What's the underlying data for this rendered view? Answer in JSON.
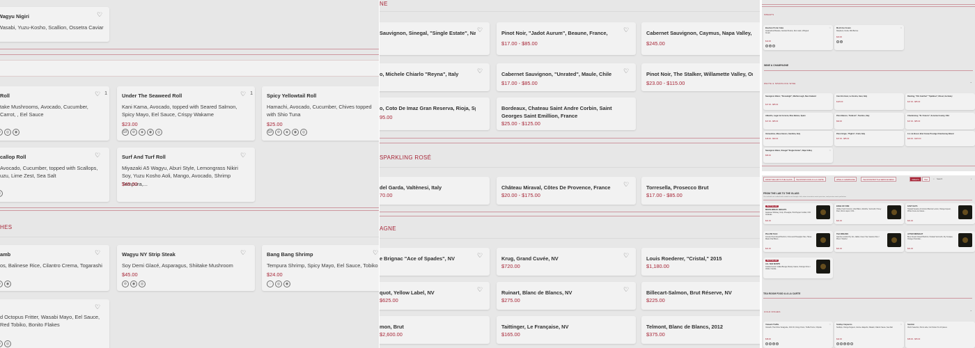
{
  "panel1": {
    "top_card": {
      "name": "Wagyu Nigiri",
      "desc": "Wasabi, Yuzu-Kosho, Scallion, Ossetra Caviar"
    },
    "roll_cards": [
      {
        "name": "Roll",
        "desc": "take Mushrooms, Avocado, Cucumber, Carrot, , Eel Sauce",
        "count": "1"
      },
      {
        "name": "Under The Seaweed Roll",
        "desc": "Kani Kama, Avocado, topped with Seared Salmon, Spicy Mayo, Eel Sauce, Crispy Wakame",
        "price": "$23.00",
        "count": "1"
      },
      {
        "name": "Spicy Yellowtail Roll",
        "desc": "Hamachi, Avocado, Cucumber, Chives topped with Shio Tuna",
        "price": "$25.00"
      },
      {
        "name": "callop Roll",
        "desc": "Avocado, Cucumber, topped with Scallops, uzu, Lime Zest, Sea Salt"
      },
      {
        "name": "Surf And Turf Roll",
        "desc": "Miyazaki A5 Wagyu, Aburi Style, Lemongrass Nikiri Soy, Yuzu Kosho Aoli, Mango, Avocado, Shrimp Tempura,...",
        "price": "$45.00"
      }
    ],
    "section_title": "HES",
    "dish_cards": [
      {
        "name": "amb",
        "desc": "os, Balinese Rice, Cilantro Crema, Togarashi"
      },
      {
        "name": "Wagyu NY Strip Steak",
        "desc": "Soy Demi Glacé, Asparagus, Shiitake Mushroom",
        "price": "$45.00"
      },
      {
        "name": "Bang Bang Shrimp",
        "desc": "Tempura Shrimp, Spicy Mayo, Eel Sauce, Tobiko",
        "price": "$24.00"
      },
      {
        "name": "",
        "desc": "d Octopus Fritter, Wasabi Mayo, Eel Sauce, Red Tobiko, Bonito Flakes"
      }
    ]
  },
  "panel2": {
    "top_section": "NE",
    "wine_rows": [
      [
        {
          "name": "Sauvignon, Sinegal, \"Single Estate\", Napa",
          "price": ""
        },
        {
          "name": "Pinot Noir, \"Jadot Aurum\", Beaune, France,",
          "price": "$17.00 - $85.00"
        },
        {
          "name": "Cabernet Sauvignon, Caymus, Napa Valley, USA",
          "price": "$245.00"
        }
      ],
      [
        {
          "name": "o, Michele Chiarlo \"Reyna\", Italy",
          "price": ""
        },
        {
          "name": "Cabernet Sauvignon, \"Unrated\", Maule, Chile",
          "price": "$17.00 - $85.00"
        },
        {
          "name": "Pinot Noir, The Stalker, Willamette Valley, Orego",
          "price": "$23.00 - $115.00"
        }
      ],
      [
        {
          "name": "o, Coto De Imaz Gran Reserva, Rioja, Spain",
          "price": "95.00"
        },
        {
          "name": "Bordeaux, Chateau Saint Andre Corbin, Saint Georges Saint Emillion, France",
          "price": "$25.00 - $125.00"
        }
      ]
    ],
    "rose_section": "SPARKLING ROSÉ",
    "rose_row": [
      {
        "name": "del Garda, Valtènesi, Italy",
        "price": "70.00"
      },
      {
        "name": "Château Miraval, Côtes De Provence, France",
        "price": "$20.00 - $175.00"
      },
      {
        "name": "Torresella, Prosecco Brut",
        "price": "$17.00 - $85.00"
      }
    ],
    "champagne_section": "AGNE",
    "champagne_rows": [
      [
        {
          "name": "e Brignac \"Ace of Spades\", NV",
          "price": ""
        },
        {
          "name": "Krug, Grand Cuvée, NV",
          "price": "$720.00"
        },
        {
          "name": "Louis Roederer, \"Cristal,\" 2015",
          "price": "$1,180.00"
        }
      ],
      [
        {
          "name": "quot, Yellow Label, NV",
          "price": "$625.00"
        },
        {
          "name": "Ruinart, Blanc de Blancs, NV",
          "price": "$275.00"
        },
        {
          "name": "Billecart-Salmon, Brut Réserve, NV",
          "price": "$225.00"
        }
      ],
      [
        {
          "name": "mon, Brut",
          "price": "$2,600.00"
        },
        {
          "name": "Taittinger, Le Française, NV",
          "price": "$165.00"
        },
        {
          "name": "Telmont, Blanc de Blancs, 2012",
          "price": "$375.00"
        }
      ]
    ]
  },
  "panel3": {
    "sweets_section": "SWEETS",
    "sweets": [
      {
        "name": "Bourbon Porter Cake",
        "desc": "Caramelized Banana, Candied Pecans, Rum raisin, Whipped Cream",
        "price": "$13.00"
      },
      {
        "name": "Mochi Ice Cream",
        "desc": "Raspberry Coulis, Wild Berries",
        "price": "$20.00"
      }
    ],
    "heading": "WINE & CHAMPAGNE",
    "white_section": "WHITE & SPARKLING WINE",
    "whites": [
      {
        "name": "Sauvignon Blanc, \"Stoneleigh\", Marlborough, New Zealand",
        "price": "$17.00 - $85.00"
      },
      {
        "name": "Cavi Gin Gavi, La Scolca, Gavi, Italy",
        "price": "$125.00"
      },
      {
        "name": "Riesling, \"Fitz Gunther\" \"Spätlese\", Mosel, Germany",
        "price": "$17.00 - $85.00"
      },
      {
        "name": "Albariño, Lagar de Cervera, Rías Baixas, Spain",
        "price": "$17.00 - $85.00"
      },
      {
        "name": "Pinot Bianco, \"Kellerei\", Trentino, Italy",
        "price": "$90.00"
      },
      {
        "name": "Chardonnay, \"St. Francis\", Sonoma County, USA",
        "price": "$17.00 - $85.00"
      },
      {
        "name": "Vermentino, Mesa Giunco, Sardinia, Italy",
        "price": "$18.00 - $90.00"
      },
      {
        "name": "Pinot Grigio, \"Pighin\", Friuli, Italy",
        "price": "$17.00 - $85.00"
      },
      {
        "name": "C.J. de Bosco Brut Cuvée Prestige Chardonnay Blend",
        "price": "$23.00 - $115.00"
      },
      {
        "name": "Sauvignon Blanc, Sinegal \"Single Estate\", Napa Valley",
        "price": "$95.00"
      }
    ]
  },
  "panel4": {
    "nav_tabs": [
      "FROM THE LAB TO THE GLASS",
      "TEA ROOM FOOD & A LA CARTE",
      "WINE & CHAMPAGNE",
      "TEA ROOM BOTTLE SERVICE MENU",
      "SWEETS",
      "TEA"
    ],
    "active_tab": "SWEETS",
    "search_label": "Search",
    "heading": "FROM THE LAB TO THE GLASS",
    "intro": "Our cocktails are crafted and curated as art through a lab, where innovative meets precision, and passion meets perfection.",
    "badge": "BESTSELLER",
    "drinks": [
      {
        "name": "MOON BREAK HEIGHTS",
        "desc": "Japanese Whiskey, Umip, Pineapple, Pink Pepper Cordial, CO2 Graduate",
        "price": "$21.00"
      },
      {
        "name": "EDGE OF FIRE",
        "desc": "Vodka, Fresh Coconut, Lillet Blanc, Absinthe, Vermouth, Honey Pear, Citron Liquor, CO2...",
        "price": "$21.00"
      },
      {
        "name": "FAST DAYS",
        "desc": "Toasted Sesame & Coconut Mezcal, Lemon, Orange Liqueur, White Creme de Cacao...",
        "price": "$21.00"
      },
      {
        "name": "PILLOW TALK",
        "desc": "Coconut Tea Infused Bourbon, Citrus and Pineapple Oleo, House Made Chai Bitters...",
        "price": "$21.00"
      },
      {
        "name": "TEA DREAMS",
        "desc": "Jasmine London Dry Gin, Jakkai, Green Tea, Sesame Oleo / Pisco / Sherbet",
        "price": "$21.00"
      },
      {
        "name": "AFTER MIDNIGHT",
        "desc": "Brew Cream Infused Bourbon, Smoked Vermouth, Dry Curaçao, Orange Chocolate...",
        "price": "$21.00"
      },
      {
        "name": "ALL SHE WANTS",
        "desc": "Cookied Lemon Vodka Beluga, Brandy Cassis, Oolongs Citrus / Vodka / Vanilla...",
        "price": "$21.00"
      }
    ],
    "food_heading": "TEA ROOM FOOD & A LA CARTE",
    "cold_section": "COLD DISHES",
    "cold": [
      {
        "name": "Yamashi Truffle",
        "desc": "Yamashi, Thai Chive Vinaigrette, Chili Oil, Crispy Onion, Truffle Ponzu, Chipotle",
        "price": "$38.00"
      },
      {
        "name": "Scallop Carpaccio",
        "desc": "Scallops, Orange Peppers, Gnome Jalapeño, Wasabi, Cilantro Sauce, Sea Salt",
        "price": "$42.00"
      },
      {
        "name": "Sashimi",
        "desc": "Chef's Selection, Ponzu side, Cut Choice 5 to 10 pieces",
        "price": "$35.00 - $65.00"
      }
    ]
  }
}
